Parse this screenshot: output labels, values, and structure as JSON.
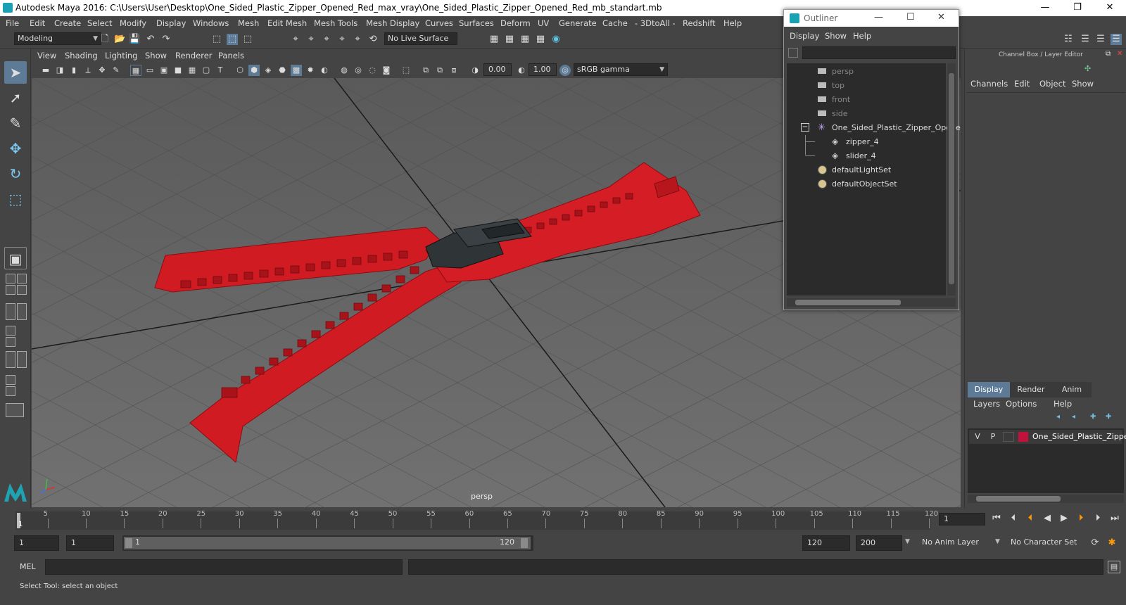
{
  "window": {
    "title": "Autodesk Maya 2016: C:\\Users\\User\\Desktop\\One_Sided_Plastic_Zipper_Opened_Red_max_vray\\One_Sided_Plastic_Zipper_Opened_Red_mb_standart.mb",
    "minimize": "—",
    "restore": "❐",
    "close": "✕"
  },
  "menubar": [
    "File",
    "Edit",
    "Create",
    "Select",
    "Modify",
    "Display",
    "Windows",
    "Mesh",
    "Edit Mesh",
    "Mesh Tools",
    "Mesh Display",
    "Curves",
    "Surfaces",
    "Deform",
    "UV",
    "Generate",
    "Cache",
    "- 3DtoAll -",
    "Redshift",
    "Help"
  ],
  "shelf": {
    "mode": "Modeling",
    "live_surface": "No Live Surface"
  },
  "viewport": {
    "menus": [
      "View",
      "Shading",
      "Lighting",
      "Show",
      "Renderer",
      "Panels"
    ],
    "exposure": "0.00",
    "gamma": "1.00",
    "color_space": "sRGB gamma",
    "camera_label": "persp"
  },
  "outliner": {
    "title": "Outliner",
    "menus": [
      "Display",
      "Show",
      "Help"
    ],
    "items": [
      {
        "label": "persp",
        "kind": "camera",
        "dim": true
      },
      {
        "label": "top",
        "kind": "camera",
        "dim": true
      },
      {
        "label": "front",
        "kind": "camera",
        "dim": true
      },
      {
        "label": "side",
        "kind": "camera",
        "dim": true
      },
      {
        "label": "One_Sided_Plastic_Zipper_Opene",
        "kind": "group",
        "dim": false
      },
      {
        "label": "zipper_4",
        "kind": "mesh",
        "dim": false
      },
      {
        "label": "slider_4",
        "kind": "mesh",
        "dim": false
      },
      {
        "label": "defaultLightSet",
        "kind": "set",
        "dim": false
      },
      {
        "label": "defaultObjectSet",
        "kind": "set",
        "dim": false
      }
    ]
  },
  "channelbox": {
    "header": "Channel Box / Layer Editor",
    "menus": [
      "Channels",
      "Edit",
      "Object",
      "Show"
    ],
    "tabs": [
      "Display",
      "Render",
      "Anim"
    ],
    "layer_menus": [
      "Layers",
      "Options",
      "Help"
    ],
    "layer": {
      "v": "V",
      "p": "P",
      "name": "One_Sided_Plastic_Zippe",
      "color": "#c0123a"
    }
  },
  "timeline": {
    "ticks": [
      "5",
      "10",
      "15",
      "20",
      "25",
      "30",
      "35",
      "40",
      "45",
      "50",
      "55",
      "60",
      "65",
      "70",
      "75",
      "80",
      "85",
      "90",
      "95",
      "100",
      "105",
      "110",
      "115",
      "120"
    ],
    "first": "1",
    "current_frame": "1"
  },
  "range": {
    "start": "1",
    "playback_start": "1",
    "slider_start": "1",
    "slider_end": "120",
    "playback_end": "120",
    "end": "200",
    "anim_layer": "No Anim Layer",
    "character_set": "No Character Set"
  },
  "command": {
    "label": "MEL"
  },
  "help": {
    "text": "Select Tool: select an object"
  }
}
